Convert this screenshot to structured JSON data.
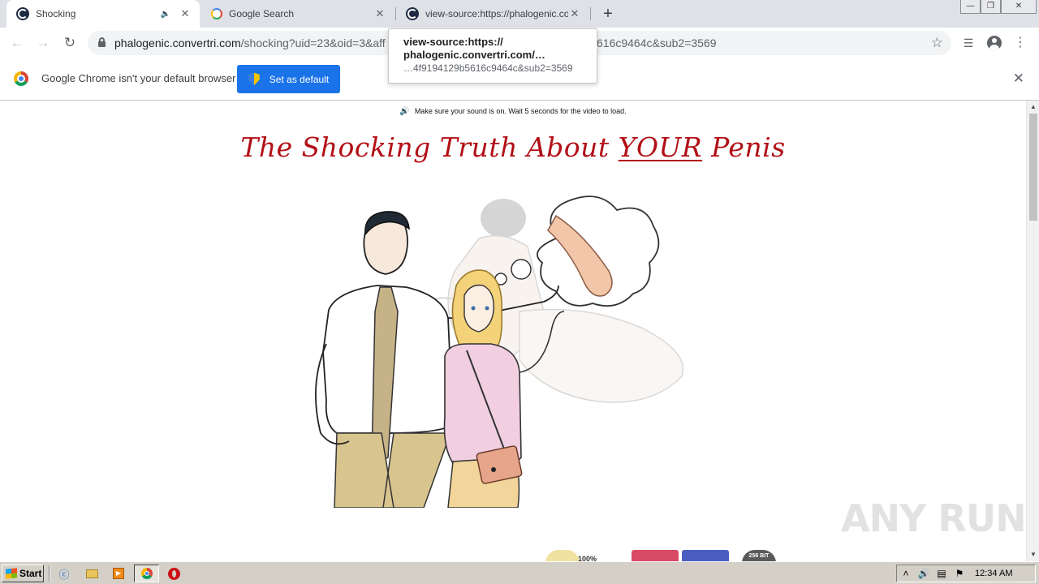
{
  "tabs": [
    {
      "title": "Shocking",
      "active": true,
      "audio": true
    },
    {
      "title": "Google Search",
      "active": false,
      "audio": false
    },
    {
      "title": "view-source:https://phalogenic.convertri.com",
      "active": false,
      "audio": false
    }
  ],
  "toolbar": {
    "url_host": "phalogenic.convertri.com",
    "url_path": "/shocking?uid=23&oid=3&aff",
    "url_tail": "616c9464c&sub2=3569"
  },
  "tooltip": {
    "line1": "view-source:https://",
    "line2": "phalogenic.convertri.com/…",
    "line3": "…4f9194129b5616c9464c&sub2=3569"
  },
  "infobar": {
    "message": "Google Chrome isn't your default browser",
    "button_label": "Set as default"
  },
  "page": {
    "sound_note": "Make sure your sound is on. Wait 5 seconds for the video to load.",
    "headline_before": "The Shocking Truth About ",
    "headline_emphasis": "YOUR",
    "headline_after": " Penis",
    "trust_badge_text": "100%",
    "secure_badge_text": "256 BIT"
  },
  "watermark": "ANY RUN",
  "taskbar": {
    "start_label": "Start",
    "clock": "12:34 AM"
  },
  "colors": {
    "headline_red": "#b20f16",
    "chrome_blue": "#1a73e8",
    "tabstrip": "#dee1e6",
    "taskbar": "#d4d0c8"
  },
  "icons": [
    "speaker-icon",
    "close-icon",
    "google-icon",
    "plus-icon",
    "back-icon",
    "forward-icon",
    "reload-icon",
    "lock-icon",
    "star-icon",
    "media-icon",
    "profile-icon",
    "chrome-logo",
    "shield-icon",
    "ie-icon",
    "folder-icon",
    "media-player-icon",
    "opera-icon"
  ]
}
